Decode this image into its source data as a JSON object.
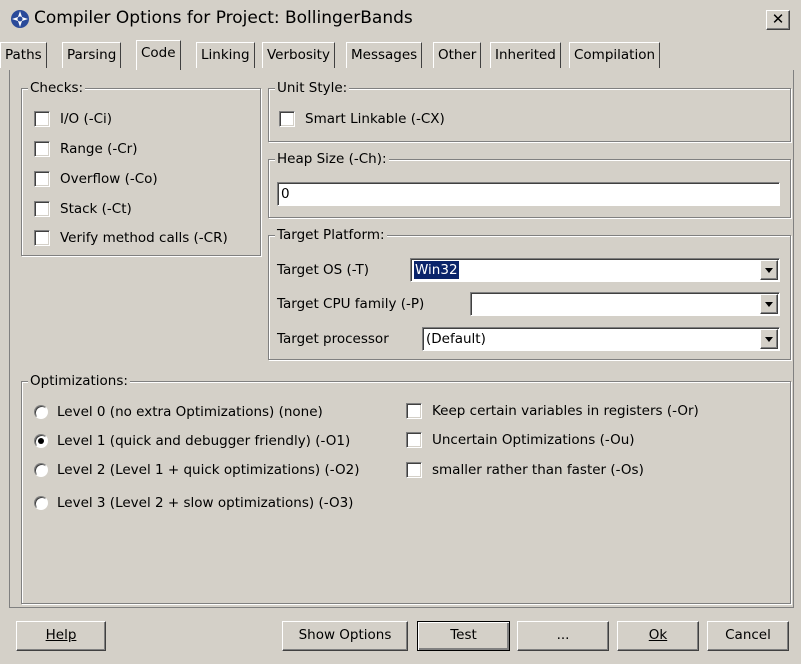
{
  "window": {
    "title": "Compiler Options for Project: BollingerBands",
    "close_glyph": "✕"
  },
  "tabs": [
    {
      "label": "Paths"
    },
    {
      "label": "Parsing"
    },
    {
      "label": "Code",
      "active": true
    },
    {
      "label": "Linking"
    },
    {
      "label": "Verbosity"
    },
    {
      "label": "Messages"
    },
    {
      "label": "Other"
    },
    {
      "label": "Inherited"
    },
    {
      "label": "Compilation"
    }
  ],
  "checks": {
    "label": "Checks:",
    "items": [
      {
        "label": "I/O (-Ci)",
        "checked": false
      },
      {
        "label": "Range (-Cr)",
        "checked": false
      },
      {
        "label": "Overflow (-Co)",
        "checked": false
      },
      {
        "label": "Stack (-Ct)",
        "checked": false
      },
      {
        "label": "Verify method calls (-CR)",
        "checked": false
      }
    ]
  },
  "unit_style": {
    "label": "Unit Style:",
    "smart_linkable": {
      "label": "Smart Linkable (-CX)",
      "checked": false
    }
  },
  "heap_size": {
    "label": "Heap Size (-Ch):",
    "value": "0"
  },
  "target_platform": {
    "label": "Target Platform:",
    "target_os": {
      "label": "Target OS (-T)",
      "value": "Win32"
    },
    "target_cpu": {
      "label": "Target CPU family (-P)",
      "value": ""
    },
    "target_processor": {
      "label": "Target processor",
      "value": "(Default)"
    }
  },
  "optimizations": {
    "label": "Optimizations:",
    "levels": [
      {
        "label": "Level 0 (no extra Optimizations) (none)",
        "checked": false
      },
      {
        "label": "Level 1 (quick and debugger friendly) (-O1)",
        "checked": true
      },
      {
        "label": "Level 2 (Level 1 + quick optimizations) (-O2)",
        "checked": false
      },
      {
        "label": "Level 3 (Level 2 + slow optimizations) (-O3)",
        "checked": false
      }
    ],
    "options": [
      {
        "label": "Keep certain variables in registers (-Or)",
        "checked": false
      },
      {
        "label": "Uncertain Optimizations (-Ou)",
        "checked": false
      },
      {
        "label": "smaller rather than faster (-Os)",
        "checked": false
      }
    ]
  },
  "buttons": {
    "help": "Help",
    "show_options": "Show Options",
    "test": "Test",
    "ellipsis": "...",
    "ok": "Ok",
    "cancel": "Cancel"
  },
  "colors": {
    "face": "#d4d0c8",
    "selection": "#0a246a"
  }
}
